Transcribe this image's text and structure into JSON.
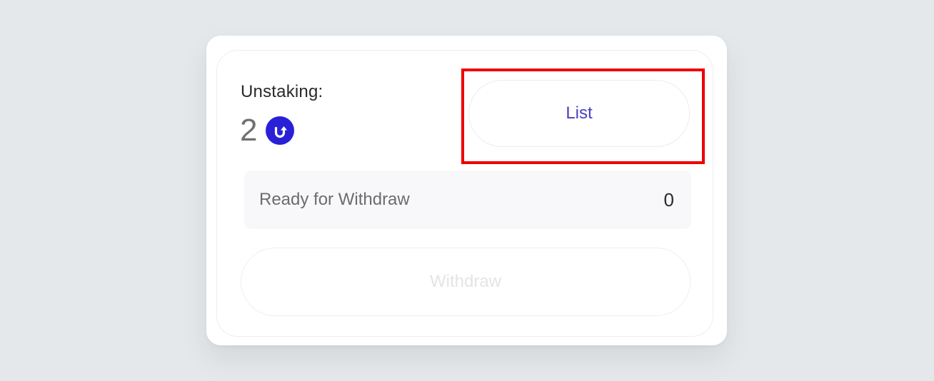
{
  "unstaking": {
    "label": "Unstaking:",
    "amount": "2",
    "token_icon": "up-arrow-token-icon",
    "token_color": "#2a20d8"
  },
  "actions": {
    "list_label": "List",
    "withdraw_label": "Withdraw",
    "withdraw_disabled": true
  },
  "ready": {
    "label": "Ready for Withdraw",
    "value": "0"
  },
  "colors": {
    "accent": "#4b3fc4",
    "highlight": "#ee0000",
    "background": "#e5e8eb"
  }
}
